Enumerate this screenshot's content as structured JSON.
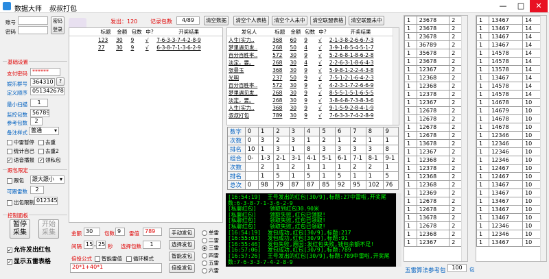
{
  "app": {
    "title": "数据大师",
    "subtitle": "叔叔打包"
  },
  "window": {
    "minimize": "—",
    "maximize": "□",
    "close": "✕"
  },
  "top": {
    "account_label": "账号",
    "password_label": "密码",
    "login_button": "密码登录",
    "out_label": "发出：120",
    "record_label": "记录包数",
    "record_value": "4/89",
    "clear_data": "清空数据",
    "clear_personal": "清空个人表格",
    "clear_personal_mine": "清空个人未中",
    "clear_union": "清空联盟表格",
    "clear_union_mine": "清空联盟未中"
  },
  "left": {
    "basic_title": "基础设置",
    "pay_pwd_label": "支付密码",
    "pay_pwd_value": "******",
    "group_no_label": "娱乐群号",
    "group_no_value": "364310",
    "order_label": "定义顺序",
    "order_value": "0513426789",
    "min_scan_label": "最小扫描",
    "min_scan_value": "1",
    "monitor_label": "监控包数",
    "monitor_value": "56789",
    "ref_label": "参考包数",
    "ref_value": "2",
    "style_label": "备注样式",
    "style_value": "普通",
    "chk_thunder_pause": "中雷暂停",
    "chk_remove": "去重",
    "chk_stat_self": "统计自己",
    "chk_remove2": "去重2",
    "chk_voice": "语音播报",
    "chk_grab": "领私包",
    "limit_title": "跟包限定",
    "chk_follow": "跟包",
    "follow_select": "跟大跟小",
    "bet_label": "可跟雷数",
    "bet_value": "2",
    "limit_label": "出包限制",
    "limit_value": "012345",
    "control_title": "控制面板",
    "pause_button": "暂停采集",
    "start_button": "开始采集",
    "allow_label": "允许发出红包",
    "show_label": "显示五雷表格"
  },
  "personal_table": {
    "headers": [
      "标题",
      "金额",
      "包数",
      "中?",
      "开奖结果"
    ],
    "rows": [
      [
        "123",
        "30",
        "9",
        "√",
        "7-6-3-3-7-4-2-8-9"
      ],
      [
        "27",
        "30",
        "9",
        "√",
        "6-3-8-7-1-3-6-2-9"
      ]
    ]
  },
  "union_table": {
    "headers": [
      "发包人",
      "标题",
      "金额",
      "包数",
      "中?",
      "开奖结果"
    ],
    "rows": [
      [
        "人生(实力..",
        "368",
        "60",
        "9",
        "√",
        "2-1-3-8-2-6-6-7-3"
      ],
      [
        "梦里遇见发..",
        "268",
        "50",
        "4",
        "√",
        "3-9-1-8-5-4-5-1-7"
      ],
      [
        "百分百胜率..",
        "572",
        "30",
        "9",
        "√",
        "5-2-6-8-1-8-6-2-8"
      ],
      [
        "淡定，要。",
        "268",
        "30",
        "4",
        "√",
        "2-2-6-3-1-8-6-4-3"
      ],
      [
        "张曼玉",
        "368",
        "30",
        "9",
        "√",
        "5-9-8-1-2-2-4-3-8"
      ],
      [
        "光明",
        "237",
        "50",
        "9",
        "√",
        "7-5-1-2-1-6-4-2-3"
      ],
      [
        "百分百胜率..",
        "572",
        "30",
        "9",
        "√",
        "4-2-3-1-7-2-6-6-9"
      ],
      [
        "梦里遇见发..",
        "268",
        "30",
        "9",
        "√",
        "8-5-5-1-5-1-6-5-5"
      ],
      [
        "淡定，要。",
        "268",
        "30",
        "9",
        "√",
        "3-8-4-8-7-3-8-3-6"
      ],
      [
        "人生(实力..",
        "368",
        "30",
        "9",
        "√",
        "9-1-5-9-2-8-4-1-9"
      ],
      [
        "叔叔打包",
        "789",
        "30",
        "9",
        "√",
        "7-6-3-3-7-4-2-8-9"
      ]
    ]
  },
  "stats": {
    "header": [
      "数字",
      "0",
      "1",
      "2",
      "3",
      "4",
      "5",
      "6",
      "7",
      "8",
      "9"
    ],
    "rows": [
      [
        "次数",
        "0",
        "3",
        "2",
        "3",
        "1",
        "2",
        "1",
        "2",
        "1",
        "1"
      ],
      [
        "排名",
        "10",
        "1",
        "3",
        "1",
        "8",
        "3",
        "3",
        "3",
        "3",
        "8"
      ],
      [
        "组合",
        "0-",
        "1-3",
        "2-1",
        "3-1",
        "4-1",
        "5-1",
        "6-1",
        "7-1",
        "8-1",
        "9-1"
      ],
      [
        "次数",
        "",
        "2",
        "1",
        "2",
        "1",
        "1",
        "1",
        "2",
        "2",
        "1"
      ],
      [
        "排名",
        "",
        "1",
        "5",
        "1",
        "5",
        "1",
        "5",
        "1",
        "1",
        "5"
      ],
      [
        "总次",
        "0",
        "98",
        "79",
        "87",
        "87",
        "85",
        "92",
        "95",
        "102",
        "76"
      ]
    ]
  },
  "bottom": {
    "amount_label": "金额",
    "amount_value": "30",
    "count_label": "包数",
    "count_value": "9",
    "thunder_label": "雷值",
    "thunder_value": "789",
    "interval_label": "间隔",
    "interval_from": "15",
    "interval_to": "25",
    "sec_label": "秒",
    "select_label": "选择包数",
    "select_value": "1",
    "formula_label": "倍投公式",
    "chk_smart": "智能雷值",
    "chk_loop": "循环模式",
    "formula_value": "20*1+40*1",
    "manual_button": "手动发包",
    "select_button": "选择发包",
    "smart_button": "智能发包",
    "multi_button": "倍投发包",
    "radios": [
      "单雷",
      "二雷",
      "三雷",
      "四雷",
      "五雷",
      "六雷"
    ],
    "radio_selected": "三雷",
    "five_label": "五雷算法参考包",
    "five_value": "100",
    "five_unit": "包"
  },
  "log_lines": [
    "[16:54:19]  王号发出的红包[30/9],标题:27中雷啦,开奖尾",
    "数:6-3-8-7-1-3-6-2-9",
    "[私聊红包]    领取到红包30.90米",
    "[私聊红包]    领取失败,红包已领取!",
    "[私聊红包]    领取失败,红包已领取!",
    "[私聊红包]    领取失败,红包已领取!",
    "[16:54:19]  发包成功,红包[30/9],标题:217",
    "[16:55:03]  发包成功,红包[30/9],标题:91",
    "[16:55:46]  发包失败,原因:发红包失败,钱包余额不足!",
    "[16:57:06]  发包成功,红包[30/9],标题:789",
    "[16:57:26]  王号发出的红包[30/9],标题:789中雷啦,开奖尾",
    "数:7-6-3-3-7-4-2-8-9"
  ],
  "score_left": [
    [
      "1",
      "23678",
      "2"
    ],
    [
      "1",
      "23678",
      "2"
    ],
    [
      "1",
      "23678",
      "2"
    ],
    [
      "1",
      "36789",
      "2"
    ],
    [
      "1",
      "35678",
      "2"
    ],
    [
      "1",
      "23678",
      "2"
    ],
    [
      "1",
      "12367",
      "2"
    ],
    [
      "1",
      "12368",
      "2"
    ],
    [
      "1",
      "12368",
      "2"
    ],
    [
      "1",
      "12378",
      "2"
    ],
    [
      "1",
      "12367",
      "2"
    ],
    [
      "1",
      "12678",
      "2"
    ],
    [
      "1",
      "12678",
      "2"
    ],
    [
      "1",
      "12678",
      "2"
    ],
    [
      "1",
      "12678",
      "2"
    ],
    [
      "1",
      "13678",
      "2"
    ],
    [
      "1",
      "12367",
      "2"
    ],
    [
      "1",
      "12368",
      "2"
    ],
    [
      "1",
      "12378",
      "2"
    ],
    [
      "1",
      "12368",
      "2"
    ],
    [
      "1",
      "12368",
      "2"
    ],
    [
      "1",
      "12369",
      "2"
    ],
    [
      "1",
      "12678",
      "2"
    ],
    [
      "1",
      "12678",
      "2"
    ],
    [
      "1",
      "13678",
      "2"
    ],
    [
      "1",
      "12678",
      "2"
    ],
    [
      "1",
      "12368",
      "2"
    ],
    [
      "1",
      "12367",
      "2"
    ]
  ],
  "score_right": [
    [
      "1",
      "13467",
      "14"
    ],
    [
      "1",
      "13467",
      "14"
    ],
    [
      "1",
      "13467",
      "14"
    ],
    [
      "1",
      "13467",
      "14"
    ],
    [
      "1",
      "14578",
      "14"
    ],
    [
      "1",
      "14578",
      "14"
    ],
    [
      "1",
      "13578",
      "14"
    ],
    [
      "1",
      "13467",
      "14"
    ],
    [
      "1",
      "14578",
      "14"
    ],
    [
      "1",
      "14578",
      "14"
    ],
    [
      "1",
      "14678",
      "10"
    ],
    [
      "1",
      "14679",
      "10"
    ],
    [
      "1",
      "14678",
      "10"
    ],
    [
      "1",
      "14678",
      "10"
    ],
    [
      "1",
      "12346",
      "10"
    ],
    [
      "1",
      "12346",
      "10"
    ],
    [
      "1",
      "12346",
      "10"
    ],
    [
      "1",
      "12346",
      "10"
    ],
    [
      "1",
      "12467",
      "10"
    ],
    [
      "1",
      "12467",
      "10"
    ],
    [
      "1",
      "13467",
      "10"
    ],
    [
      "1",
      "13467",
      "10"
    ],
    [
      "1",
      "13467",
      "10"
    ],
    [
      "1",
      "13467",
      "10"
    ],
    [
      "1",
      "13467",
      "10"
    ],
    [
      "1",
      "12346",
      "10"
    ],
    [
      "1",
      "12346",
      "10"
    ],
    [
      "1",
      "13467",
      "10"
    ]
  ],
  "colors": {
    "red": "#e00000",
    "blue": "#0060c0",
    "log_bg": "#000000",
    "log_fg": "#00ff00"
  }
}
